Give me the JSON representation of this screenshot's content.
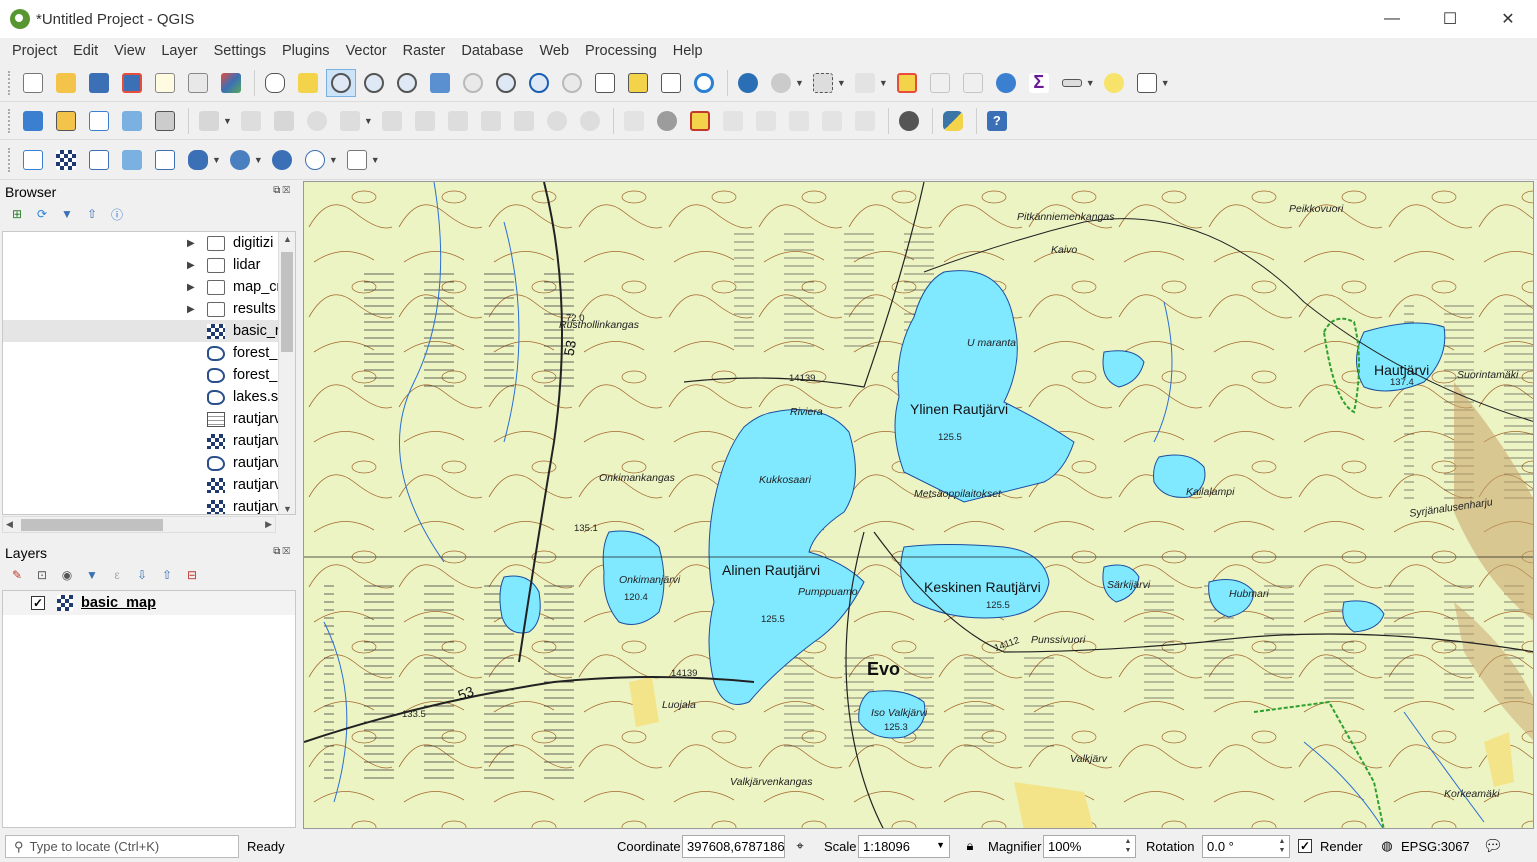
{
  "window": {
    "title": "*Untitled Project - QGIS",
    "minimize": "—",
    "maximize": "☐",
    "close": "✕"
  },
  "menu": [
    "Project",
    "Edit",
    "View",
    "Layer",
    "Settings",
    "Plugins",
    "Vector",
    "Raster",
    "Database",
    "Web",
    "Processing",
    "Help"
  ],
  "browser": {
    "title": "Browser",
    "items": [
      {
        "label": "digitizi",
        "type": "folder"
      },
      {
        "label": "lidar",
        "type": "folder"
      },
      {
        "label": "map_cr",
        "type": "folder"
      },
      {
        "label": "results",
        "type": "folder"
      },
      {
        "label": "basic_r",
        "type": "raster"
      },
      {
        "label": "forest_",
        "type": "polygon"
      },
      {
        "label": "forest_",
        "type": "polygon"
      },
      {
        "label": "lakes.sh",
        "type": "polygon"
      },
      {
        "label": "rautjarv",
        "type": "table"
      },
      {
        "label": "rautjarv",
        "type": "raster"
      },
      {
        "label": "rautjarv",
        "type": "polygon"
      },
      {
        "label": "rautjarv",
        "type": "raster"
      },
      {
        "label": "rautjarv",
        "type": "raster"
      }
    ]
  },
  "layers": {
    "title": "Layers",
    "items": [
      {
        "name": "basic_map",
        "checked": true,
        "check_glyph": "✓"
      }
    ]
  },
  "map": {
    "labels": {
      "pitkanniemenkangas": "Pitkänniemenkangas",
      "peikkovuori": "Peikkovuori",
      "kaivo": "Kaivo",
      "rustholliinkangas": "Rusthollinkangas",
      "umaranta": "U maranta",
      "ylinen": "Ylinen Rautjärvi",
      "ylinen_elev": "125.5",
      "riviera": "Riviera",
      "kukkosaari": "Kukkosaari",
      "onkimankangas": "Onkimankangas",
      "alinen": "Alinen Rautjärvi",
      "alinen_elev": "125.5",
      "pumppuamo": "Pumppuamo",
      "keskinen": "Keskinen Rautjärvi",
      "keskinen_elev": "125.5",
      "evo": "Evo",
      "isovalkjarvi": "Iso Valkjärvi",
      "isovalk_elev": "125.3",
      "hautjarvi": "Hautjärvi",
      "hautjarvi_elev": "137.4",
      "suorintamaki": "Suorintamäki",
      "sarkijarvi": "Särkijärvi",
      "hubmari": "Hubmari",
      "punssivuori": "Punssivuori",
      "valkjarvenkangas": "Valkjärvenkangas",
      "korkeamaki": "Korkeamäki",
      "luojala": "Luojala",
      "onkimanjarvi": "Onkimanjärvi",
      "onkiman_elev": "120.4",
      "road53a": "53",
      "road53b": "53",
      "road14139": "14139",
      "road14112": "14112",
      "elev72": "72.0",
      "elev135": "135.1",
      "elev1335": "133.5",
      "syrjanalusenharju": "Syrjänalusenharju",
      "kailalampi": "Kailalampi",
      "motsoppilaitokset": "Metsäoppilaitokset",
      "valkjarv": "Valkjärv"
    }
  },
  "status": {
    "locator_placeholder": "Type to locate (Ctrl+K)",
    "ready": "Ready",
    "coordinate_label": "Coordinate",
    "coordinate": "397608,6787186",
    "scale_label": "Scale",
    "scale": "1:18096",
    "magnifier_label": "Magnifier",
    "magnifier": "100%",
    "rotation_label": "Rotation",
    "rotation": "0.0 °",
    "render_label": "Render",
    "render_check": "✓",
    "crs": "EPSG:3067"
  }
}
